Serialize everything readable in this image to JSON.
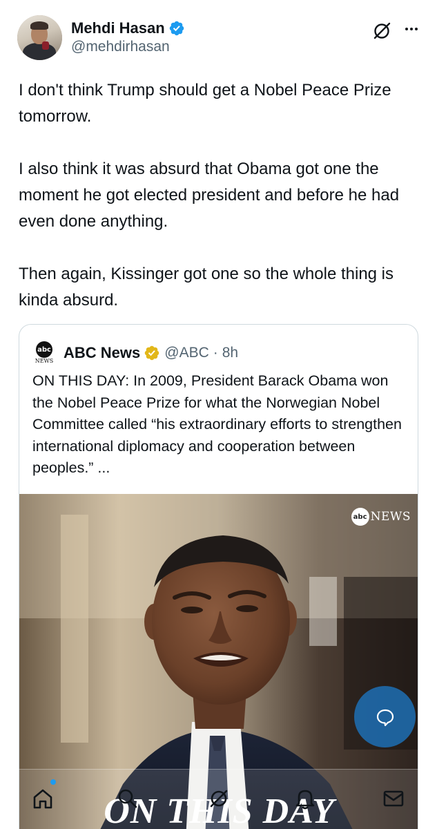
{
  "author": {
    "display_name": "Mehdi Hasan",
    "handle": "@mehdirhasan"
  },
  "tweet": {
    "paragraphs": [
      "I don't think Trump should get a Nobel Peace Prize tomorrow.",
      "I also think it was absurd that Obama got one the moment he got elected president and before he had even done anything.",
      "Then again, Kissinger got one so the whole thing is kinda absurd."
    ]
  },
  "quoted": {
    "logo_text": "abc",
    "logo_sub": "NEWS",
    "display_name": "ABC News",
    "handle": "@ABC",
    "separator": "·",
    "time": "8h",
    "text": "ON THIS DAY: In 2009, President Barack Obama won the Nobel Peace Prize for what the Norwegian Nobel Committee called “his extraordinary efforts to strengthen international diplomacy and cooperation between peoples.” ...",
    "image": {
      "watermark_logo": "abc",
      "watermark_text": "NEWS",
      "caption": "ON THIS DAY"
    }
  },
  "icons": {
    "verified": "verified-badge-icon",
    "gold_verified": "gold-verified-badge-icon",
    "grok": "grok-icon",
    "more": "more-icon",
    "compose": "compose-reply-icon",
    "nav": [
      "home-icon",
      "search-icon",
      "grok-nav-icon",
      "notifications-icon",
      "messages-icon"
    ]
  },
  "colors": {
    "text_primary": "#0f1419",
    "text_secondary": "#536471",
    "verified_blue": "#1d9bf0",
    "business_gold": "#e2b719",
    "card_border": "#cfd9de"
  }
}
